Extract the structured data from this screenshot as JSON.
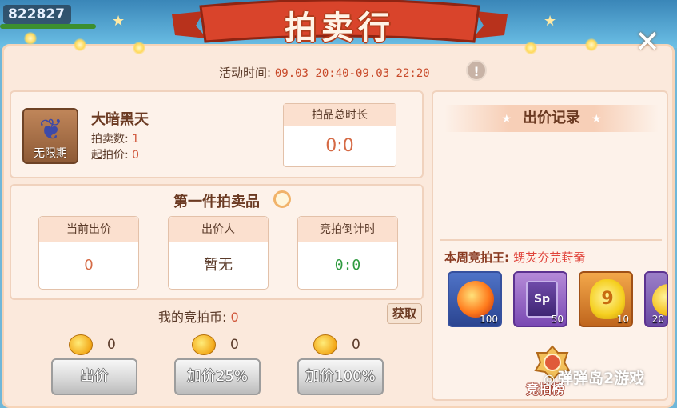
{
  "top": {
    "score": "822827"
  },
  "header": {
    "title": "拍卖行",
    "close_icon": "close-icon"
  },
  "activity": {
    "label": "活动时间:",
    "time": "09.03 20:40-09.03 22:20",
    "info": "!"
  },
  "item": {
    "icon_tag": "无限期",
    "name": "大暗黑天",
    "quantity_label": "拍卖数:",
    "quantity": "1",
    "start_price_label": "起拍价:",
    "start_price": "0",
    "total_duration_label": "拍品总时长",
    "total_duration": "0:0"
  },
  "lot": {
    "title": "第一件拍卖品",
    "current_bid_label": "当前出价",
    "current_bid": "0",
    "bidder_label": "出价人",
    "bidder": "暂无",
    "countdown_label": "竞拍倒计时",
    "countdown": "0:0"
  },
  "wallet": {
    "coins_label": "我的竞拍币:",
    "coins": "0",
    "obtain_label": "获取"
  },
  "actions": [
    {
      "coin": "0",
      "label": "出价"
    },
    {
      "coin": "0",
      "label": "加价25%"
    },
    {
      "coin": "0",
      "label": "加价100%"
    }
  ],
  "record": {
    "title": "出价记录",
    "king_label": "本周竞拍王:",
    "king_name": "甥炗夯芫葑奣",
    "rewards": [
      {
        "icon": "fire-orb-icon",
        "count": "100"
      },
      {
        "icon": "sp-card-icon",
        "count": "50",
        "text": "Sp"
      },
      {
        "icon": "gold-gem-icon",
        "count": "10",
        "text": "9"
      },
      {
        "icon": "gold-orb-icon",
        "count": "20"
      }
    ],
    "badge_label": "竞拍榜"
  },
  "watermark": "弹弹岛2游戏",
  "colors": {
    "panel": "#fbe9dc",
    "banner": "#d9442b",
    "accent_text": "#d0563a",
    "countdown": "#2e9a3f"
  }
}
